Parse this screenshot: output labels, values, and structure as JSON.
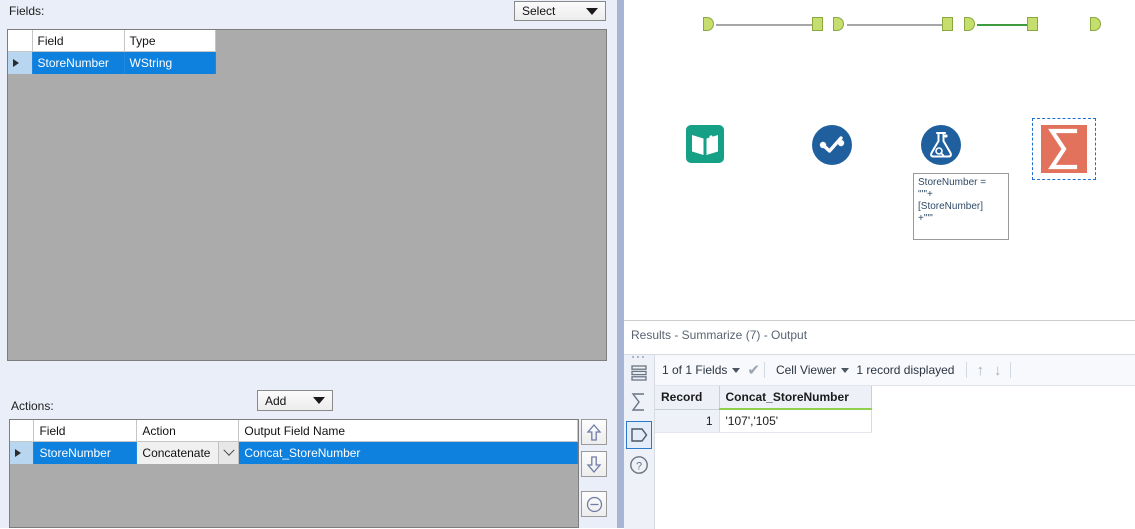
{
  "app": {
    "left_pane": {
      "fields_label": "Fields:",
      "actions_label": "Actions:",
      "select_dropdown": {
        "value": "Select",
        "icon": "chevron-down-icon"
      },
      "add_dropdown": {
        "value": "Add",
        "icon": "chevron-down-icon"
      },
      "fields_table": {
        "columns": [
          "",
          "Field",
          "Type"
        ],
        "rows": [
          {
            "marker": "▶",
            "field": "StoreNumber",
            "type": "WString",
            "selected": true
          }
        ]
      },
      "actions_table": {
        "columns": [
          "",
          "Field",
          "Action",
          "Output Field Name"
        ],
        "rows": [
          {
            "marker": "▶",
            "field": "StoreNumber",
            "action": "Concatenate",
            "output_field_name": "Concat_StoreNumber",
            "selected": true
          }
        ]
      },
      "side_buttons": [
        {
          "name": "move-up-button",
          "icon": "arrow-up-icon",
          "tooltip": "Move Up"
        },
        {
          "name": "move-down-button",
          "icon": "arrow-down-icon",
          "tooltip": "Move Down"
        },
        {
          "name": "remove-button",
          "icon": "minus-circle-icon",
          "tooltip": "Remove"
        }
      ]
    },
    "canvas": {
      "nodes": [
        {
          "id": "input-data",
          "icon": "book-icon",
          "color": "#16a085",
          "label": ""
        },
        {
          "id": "select",
          "icon": "check-circle-icon",
          "color": "#1f5f9e",
          "label": ""
        },
        {
          "id": "formula",
          "icon": "flask-icon",
          "color": "#1f5f9e",
          "label": ""
        },
        {
          "id": "summarize",
          "icon": "sigma-icon",
          "color": "#e2725b",
          "label": "",
          "selected": true
        }
      ],
      "annotation": {
        "line1": "StoreNumber =",
        "line2": "\"'\"+",
        "line3": "[StoreNumber]",
        "line4": "+\"'\""
      }
    },
    "results": {
      "title": "Results - Summarize (7) - Output",
      "toolbar": {
        "fields_selector": "1 of 1 Fields",
        "check_icon": "check-icon",
        "view_mode": "Cell Viewer",
        "record_count": "1 record displayed",
        "nav_up_icon": "arrow-up-icon",
        "nav_down_icon": "arrow-down-icon"
      },
      "sidebar_icons": [
        {
          "name": "data-grid-icon",
          "selected": false
        },
        {
          "name": "sigma-icon",
          "selected": false
        },
        {
          "name": "tag-icon",
          "selected": true
        },
        {
          "name": "help-icon",
          "selected": false
        }
      ],
      "grid": {
        "columns": [
          "Record",
          "Concat_StoreNumber"
        ],
        "rows": [
          {
            "record": "1",
            "concat_storenumber": "'107','105'"
          }
        ]
      }
    }
  }
}
